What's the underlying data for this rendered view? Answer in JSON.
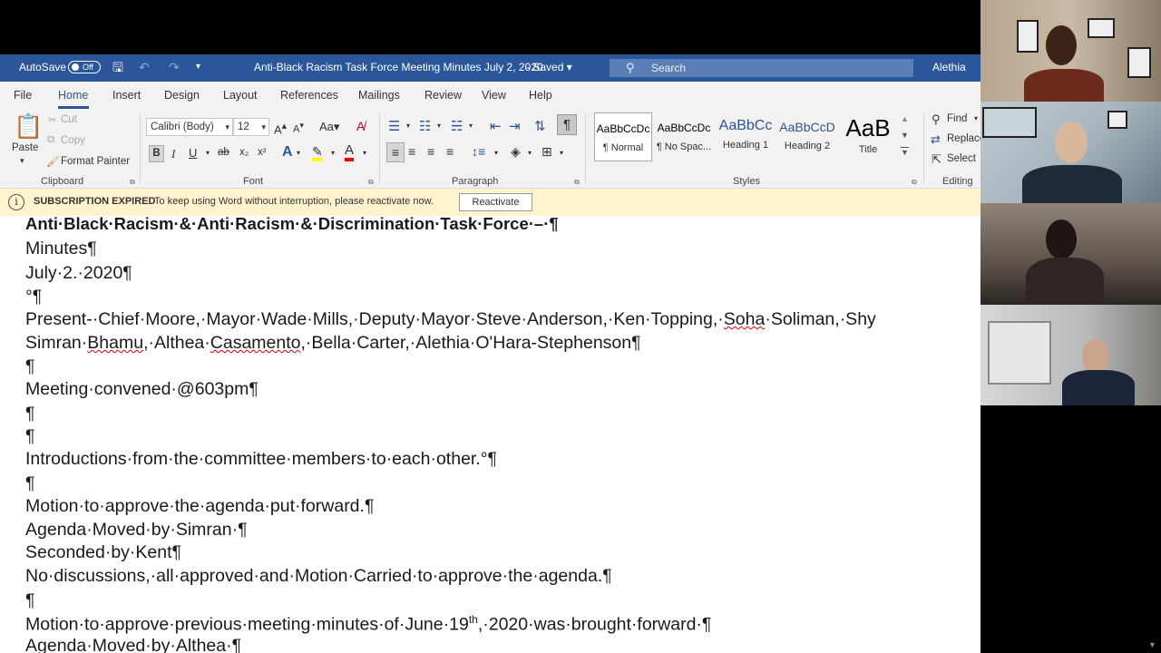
{
  "titlebar": {
    "autosave_label": "AutoSave",
    "autosave_state": "Off",
    "doc_title": "Anti-Black Racism Task Force Meeting Minutes July 2, 2020",
    "saved_status": "Saved",
    "search_placeholder": "Search",
    "user_name": "Alethia"
  },
  "menu": {
    "tabs": [
      "File",
      "Home",
      "Insert",
      "Design",
      "Layout",
      "References",
      "Mailings",
      "Review",
      "View",
      "Help"
    ],
    "active_tab": "Home"
  },
  "ribbon": {
    "clipboard": {
      "paste": "Paste",
      "cut": "Cut",
      "copy": "Copy",
      "format_painter": "Format Painter",
      "label": "Clipboard"
    },
    "font": {
      "font_name": "Calibri (Body)",
      "font_size": "12",
      "label": "Font",
      "bold": "B",
      "italic": "I",
      "underline": "U",
      "strike": "ab",
      "subscript": "x₂",
      "superscript": "x²"
    },
    "paragraph": {
      "label": "Paragraph"
    },
    "styles": {
      "label": "Styles",
      "items": [
        {
          "preview": "AaBbCcDc",
          "name": "¶ Normal"
        },
        {
          "preview": "AaBbCcDc",
          "name": "¶ No Spac..."
        },
        {
          "preview": "AaBbCc",
          "name": "Heading 1"
        },
        {
          "preview": "AaBbCcD",
          "name": "Heading 2"
        },
        {
          "preview": "AaB",
          "name": "Title"
        }
      ]
    },
    "editing": {
      "find": "Find",
      "replace": "Replace",
      "select": "Select",
      "label": "Editing"
    }
  },
  "notification": {
    "title": "SUBSCRIPTION EXPIRED",
    "message": "To keep using Word without interruption, please reactivate now.",
    "button": "Reactivate"
  },
  "document": {
    "heading": "Anti·Black·Racism·&·Anti·Racism·&·Discrimination·Task·Force·–·¶",
    "l1": "Minutes¶",
    "l2": "July·2.·2020¶",
    "l3": "°¶",
    "l4_pre": "Present-·Chief·Moore,·Mayor·Wade·Mills,·Deputy·Mayor·Steve·Anderson,·Ken·Topping,·",
    "l4_sq": "Soha",
    "l4_post": "·Soliman,·Shy",
    "l5_a": "Simran·",
    "l5_sq1": "Bhamu",
    "l5_b": ",·Althea·",
    "l5_sq2": "Casamento",
    "l5_c": ",·Bella·Carter,·Alethia·O'Hara-Stephenson¶",
    "l6": "¶",
    "l7": "Meeting·convened·@603pm¶",
    "l8": "¶",
    "l9": "¶",
    "l10": "Introductions·from·the·committee·members·to·each·other.°¶",
    "l11": "¶",
    "l12": "Motion·to·approve·the·agenda·put·forward.¶",
    "l13": "Agenda·Moved·by·Simran·¶",
    "l14": "Seconded·by·Kent¶",
    "l15": "No·discussions,·all·approved·and·Motion·Carried·to·approve·the·agenda.¶",
    "l16": "¶",
    "l17_pre": "Motion·to·approve·previous·meeting·minutes·of·June·19",
    "l17_sup": "th",
    "l17_post": ",·2020·was·brought·forward·¶",
    "l18": "Agenda·Moved·by·Althea·¶"
  },
  "colors": {
    "word_blue": "#2b579a",
    "notify_bg": "#fff4ce"
  }
}
